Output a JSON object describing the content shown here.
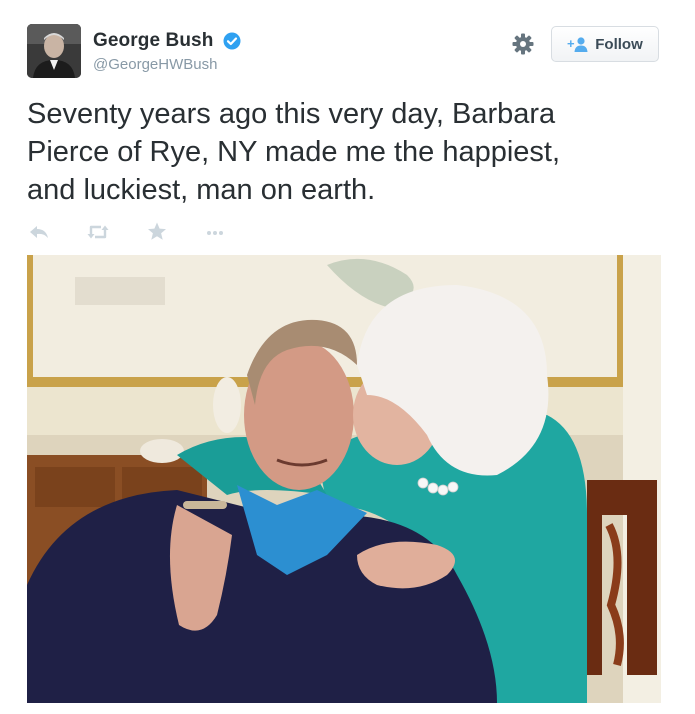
{
  "tweet": {
    "author": {
      "name": "George Bush",
      "handle": "@GeorgeHWBush",
      "verified": true,
      "avatar_icon": "profile-photo"
    },
    "follow_button": {
      "label": "Follow",
      "icon": "add-user-icon"
    },
    "settings_icon": "gear-icon",
    "text": "Seventy years ago this very day, Barbara\nPierce of Rye, NY made me the happiest,\nand luckiest, man on earth.",
    "actions": [
      "reply-icon",
      "retweet-icon",
      "favorite-icon",
      "more-icon"
    ],
    "photo": {
      "description": "elderly woman kissing elderly man on the cheek"
    }
  },
  "colors": {
    "text": "#292f33",
    "secondary": "#8899a6",
    "verified_blue": "#2fa1f1",
    "follow_icon_blue": "#55acee",
    "action_grey": "#ccd6dd"
  }
}
